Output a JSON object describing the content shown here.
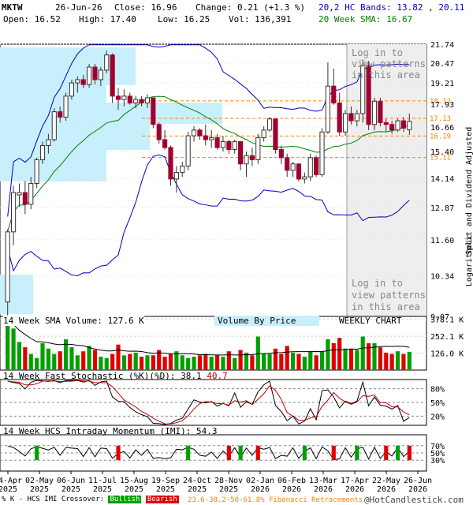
{
  "header": {
    "ticker": "MKTW",
    "date": "26-Jun-26",
    "close_label": "Close: 16.96",
    "change_label": "Change: 0.21 (+1.3 %)",
    "open_label": "Open: 16.52",
    "high_label": "High: 17.40",
    "low_label": "Low: 16.25",
    "vol_label": "Vol: 136,391",
    "bands_label": "20,2 HC Bands: 13.82 , 20.11",
    "sma_label": "20 Week SMA: 16.67"
  },
  "colors": {
    "up": "#00a000",
    "down": "#a00030",
    "band": "#0000c0",
    "sma": "#008000",
    "fib": "#ff8000",
    "vbp": "#c8f0fc",
    "shade": "#eeeeee"
  },
  "price_panel": {
    "axis_right_label": "Split and Dividend Adjusted",
    "scale_label": "Logarithmic",
    "login_text_1": [
      "Log in to",
      "view patterns",
      "in this area"
    ],
    "login_text_2": [
      "Log in to",
      "view patterns",
      "in this area"
    ],
    "y_ticks": [
      "21.74",
      "20.47",
      "19.21",
      "17.93",
      "16.66",
      "15.40",
      "14.14",
      "12.87",
      "11.60",
      "10.34",
      "9.07"
    ],
    "fib_levels": [
      "18.12",
      "17.13",
      "16.19",
      "15.11"
    ]
  },
  "volume_panel": {
    "title": "14 Week SMA Volume: 127.6 K",
    "vbp_label": "Volume By Price",
    "chart_label": "WEEKLY CHART",
    "y_ticks": [
      "378.1 K",
      "252.1 K",
      "126.0 K"
    ]
  },
  "stoch_panel": {
    "title": "14 Week Fast Stochastic (%K)(%D): 38.1",
    "d_value": "40.7",
    "y_ticks": [
      "80%",
      "50%",
      "20%"
    ]
  },
  "imi_panel": {
    "title": "14 Week HCS Intraday Momentum (IMI): 54.3",
    "y_ticks": [
      "70%",
      "50%",
      "30%"
    ]
  },
  "x_axis": {
    "ticks": [
      {
        "m": "04-Apr",
        "y": "2025"
      },
      {
        "m": "02-May",
        "y": "2025"
      },
      {
        "m": "06-Jun",
        "y": "2025"
      },
      {
        "m": "11-Jul",
        "y": "2025"
      },
      {
        "m": "15-Aug",
        "y": "2025"
      },
      {
        "m": "19-Sep",
        "y": "2025"
      },
      {
        "m": "24-Oct",
        "y": "2025"
      },
      {
        "m": "28-Nov",
        "y": "2025"
      },
      {
        "m": "02-Jan",
        "y": "2026"
      },
      {
        "m": "06-Feb",
        "y": "2026"
      },
      {
        "m": "13-Mar",
        "y": "2026"
      },
      {
        "m": "17-Apr",
        "y": "2026"
      },
      {
        "m": "22-May",
        "y": "2026"
      },
      {
        "m": "26-Jun",
        "y": "2026"
      }
    ]
  },
  "footer": {
    "legend_prefix": "% K - HCS IMI Crossover:",
    "bullish": "Bullish",
    "bearish": "Bearish",
    "fib_note": "23.6-38.2-50-61.8% Fibonacci Retracements",
    "copyright": "@HotCandlestick.com"
  },
  "chart_data": {
    "type": "candlestick",
    "frequency": "weekly",
    "y_scale": "log",
    "ylim": [
      9.07,
      21.74
    ],
    "x_range": [
      "04-Apr-2025",
      "26-Jun-2026"
    ],
    "last_bar": {
      "date": "26-Jun-26",
      "open": 16.52,
      "high": 17.4,
      "low": 16.25,
      "close": 16.96,
      "volume": 136391
    },
    "hc_bands": {
      "lower": 13.82,
      "upper": 20.11
    },
    "sma20": 16.67,
    "fibonacci": [
      18.12,
      17.13,
      16.19,
      15.11
    ],
    "volume_sma14": 127.6,
    "stoch_k": 38.1,
    "stoch_d": 40.7,
    "imi": 54.3,
    "candles": [
      [
        9.5,
        12.0,
        9.1,
        11.9
      ],
      [
        11.9,
        13.8,
        11.4,
        13.5
      ],
      [
        13.4,
        13.9,
        12.9,
        13.5
      ],
      [
        13.5,
        14.0,
        12.6,
        13.0
      ],
      [
        13.0,
        14.2,
        12.8,
        13.9
      ],
      [
        13.9,
        15.1,
        13.7,
        15.0
      ],
      [
        15.0,
        15.9,
        14.8,
        15.7
      ],
      [
        15.7,
        16.3,
        15.3,
        16.0
      ],
      [
        16.0,
        17.7,
        15.9,
        17.5
      ],
      [
        17.5,
        17.8,
        16.9,
        17.2
      ],
      [
        17.2,
        18.6,
        17.0,
        18.4
      ],
      [
        18.4,
        19.4,
        18.2,
        19.2
      ],
      [
        19.2,
        19.6,
        18.6,
        19.4
      ],
      [
        19.4,
        19.7,
        18.9,
        19.1
      ],
      [
        19.1,
        20.4,
        18.9,
        20.2
      ],
      [
        20.2,
        20.4,
        19.1,
        19.4
      ],
      [
        19.4,
        20.2,
        19.0,
        20.0
      ],
      [
        20.0,
        21.3,
        19.8,
        21.0
      ],
      [
        21.0,
        21.1,
        18.0,
        18.4
      ],
      [
        18.4,
        18.9,
        17.6,
        18.2
      ],
      [
        18.2,
        18.8,
        17.8,
        18.4
      ],
      [
        18.4,
        18.6,
        17.9,
        18.0
      ],
      [
        18.0,
        18.4,
        17.7,
        18.2
      ],
      [
        18.2,
        18.4,
        17.8,
        18.0
      ],
      [
        18.0,
        18.5,
        17.7,
        18.3
      ],
      [
        18.3,
        18.2,
        16.6,
        16.8
      ],
      [
        16.8,
        16.9,
        15.8,
        16.0
      ],
      [
        16.0,
        16.5,
        15.5,
        15.6
      ],
      [
        15.6,
        15.7,
        13.8,
        14.1
      ],
      [
        14.1,
        14.7,
        13.5,
        14.4
      ],
      [
        14.4,
        14.9,
        14.2,
        14.7
      ],
      [
        14.7,
        16.4,
        14.5,
        16.2
      ],
      [
        16.2,
        16.7,
        15.9,
        16.5
      ],
      [
        16.5,
        16.6,
        16.0,
        16.2
      ],
      [
        16.2,
        16.8,
        15.7,
        16.0
      ],
      [
        16.0,
        16.5,
        15.6,
        16.1
      ],
      [
        16.1,
        16.3,
        15.5,
        15.6
      ],
      [
        15.6,
        16.2,
        15.4,
        15.9
      ],
      [
        15.9,
        16.0,
        15.3,
        15.5
      ],
      [
        15.5,
        16.0,
        15.3,
        15.9
      ],
      [
        15.9,
        15.9,
        14.5,
        14.8
      ],
      [
        14.8,
        15.4,
        14.2,
        15.2
      ],
      [
        15.2,
        15.6,
        14.7,
        15.0
      ],
      [
        15.0,
        16.3,
        14.8,
        16.1
      ],
      [
        16.1,
        16.7,
        15.9,
        16.5
      ],
      [
        16.5,
        17.2,
        16.4,
        17.1
      ],
      [
        17.1,
        17.1,
        15.3,
        15.5
      ],
      [
        15.5,
        15.7,
        14.8,
        15.1
      ],
      [
        15.1,
        15.3,
        14.2,
        14.5
      ],
      [
        14.5,
        14.9,
        14.2,
        14.8
      ],
      [
        14.8,
        14.8,
        14.0,
        14.1
      ],
      [
        14.1,
        14.4,
        13.9,
        14.2
      ],
      [
        14.2,
        15.3,
        14.0,
        15.1
      ],
      [
        15.1,
        15.2,
        14.2,
        14.3
      ],
      [
        14.3,
        16.6,
        14.2,
        16.4
      ],
      [
        16.4,
        20.5,
        16.3,
        19.0
      ],
      [
        19.0,
        20.1,
        17.9,
        18.0
      ],
      [
        18.0,
        18.6,
        16.2,
        16.4
      ],
      [
        16.4,
        17.6,
        16.2,
        17.4
      ],
      [
        17.4,
        17.8,
        16.8,
        17.0
      ],
      [
        17.0,
        17.6,
        16.7,
        17.4
      ],
      [
        17.4,
        20.7,
        16.9,
        20.3
      ],
      [
        20.3,
        20.6,
        16.5,
        16.8
      ],
      [
        16.8,
        18.3,
        16.5,
        18.1
      ],
      [
        18.1,
        18.3,
        16.7,
        16.9
      ],
      [
        16.9,
        17.1,
        16.4,
        16.8
      ],
      [
        16.8,
        17.0,
        16.3,
        16.5
      ],
      [
        16.5,
        17.1,
        16.4,
        17.0
      ],
      [
        17.0,
        17.2,
        16.4,
        16.6
      ],
      [
        16.52,
        17.4,
        16.25,
        16.96
      ]
    ],
    "volume": [
      370,
      310,
      210,
      170,
      120,
      90,
      200,
      160,
      120,
      140,
      230,
      170,
      110,
      140,
      180,
      150,
      100,
      90,
      120,
      190,
      110,
      120,
      130,
      100,
      110,
      110,
      150,
      100,
      120,
      140,
      110,
      90,
      100,
      110,
      120,
      100,
      110,
      100,
      140,
      90,
      150,
      130,
      110,
      250,
      120,
      120,
      160,
      120,
      180,
      130,
      120,
      100,
      140,
      110,
      140,
      230,
      200,
      240,
      160,
      160,
      150,
      250,
      200,
      200,
      170,
      130,
      120,
      140,
      120,
      136
    ],
    "stoch_k_series": [],
    "imi_series": []
  }
}
